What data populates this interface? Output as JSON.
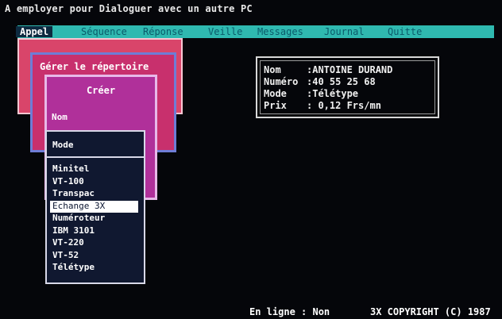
{
  "title": "A employer pour Dialoguer avec un autre PC",
  "menu": [
    {
      "label": "Appel",
      "active": true
    },
    {
      "label": "Séquence",
      "active": false
    },
    {
      "label": "Réponse",
      "active": false
    },
    {
      "label": "Veille",
      "active": false
    },
    {
      "label": "Messages",
      "active": false
    },
    {
      "label": "Journal",
      "active": false
    },
    {
      "label": "Quitte",
      "active": false
    }
  ],
  "windows": {
    "gerer_title": "Gérer le répertoire",
    "creer_title": "Créer",
    "nom_field": "Nom"
  },
  "mode_popup": {
    "header": "Mode",
    "options": [
      "Minitel",
      "VT-100",
      "Transpac",
      "Echange 3X",
      "Numéroteur",
      "IBM 3101",
      "VT-220",
      "VT-52",
      "Télétype"
    ],
    "selected": "Echange 3X"
  },
  "info": {
    "rows": [
      {
        "key": "Nom",
        "value": ":ANTOINE DURAND"
      },
      {
        "key": "Numéro",
        "value": ":40 55 25 68"
      },
      {
        "key": "Mode",
        "value": ":Télétype"
      },
      {
        "key": "Prix",
        "value": ": 0,12 Frs/mn"
      }
    ]
  },
  "status": {
    "connection": "En ligne : Non",
    "copyright": "3X COPYRIGHT (C) 1987"
  },
  "colors": {
    "screen_bg": "#05060a",
    "menubar": "#2fb9b0",
    "red_window": "#d9456a",
    "magenta_window": "#c8306d",
    "creer_window": "#b0309a",
    "popup_bg": "#101830"
  }
}
